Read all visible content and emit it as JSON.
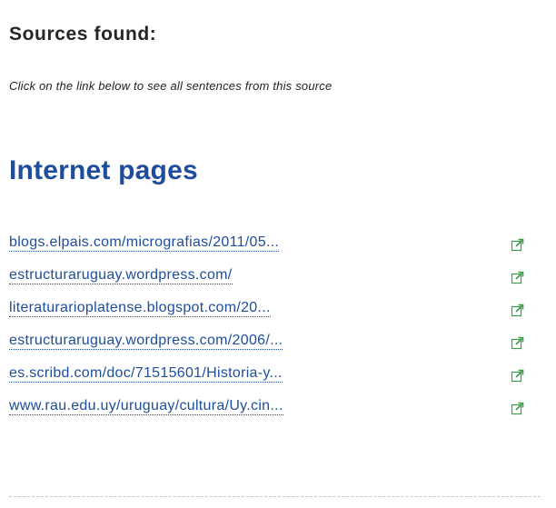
{
  "header": {
    "title": "Sources found:",
    "instruction": "Click on the link below to see all sentences from this source"
  },
  "section": {
    "heading": "Internet pages"
  },
  "sources": [
    {
      "label": "blogs.elpais.com/micrografias/2011/05...",
      "icon": "external-link-icon"
    },
    {
      "label": "estructuraruguay.wordpress.com/",
      "icon": "external-link-icon"
    },
    {
      "label": "literaturarioplatense.blogspot.com/20...",
      "icon": "external-link-icon"
    },
    {
      "label": "estructuraruguay.wordpress.com/2006/...",
      "icon": "external-link-icon"
    },
    {
      "label": "es.scribd.com/doc/71515601/Historia-y...",
      "icon": "external-link-icon"
    },
    {
      "label": "www.rau.edu.uy/uruguay/cultura/Uy.cin...",
      "icon": "external-link-icon"
    }
  ],
  "colors": {
    "link": "#1e4d9c",
    "icon_green": "#3aa04a"
  }
}
